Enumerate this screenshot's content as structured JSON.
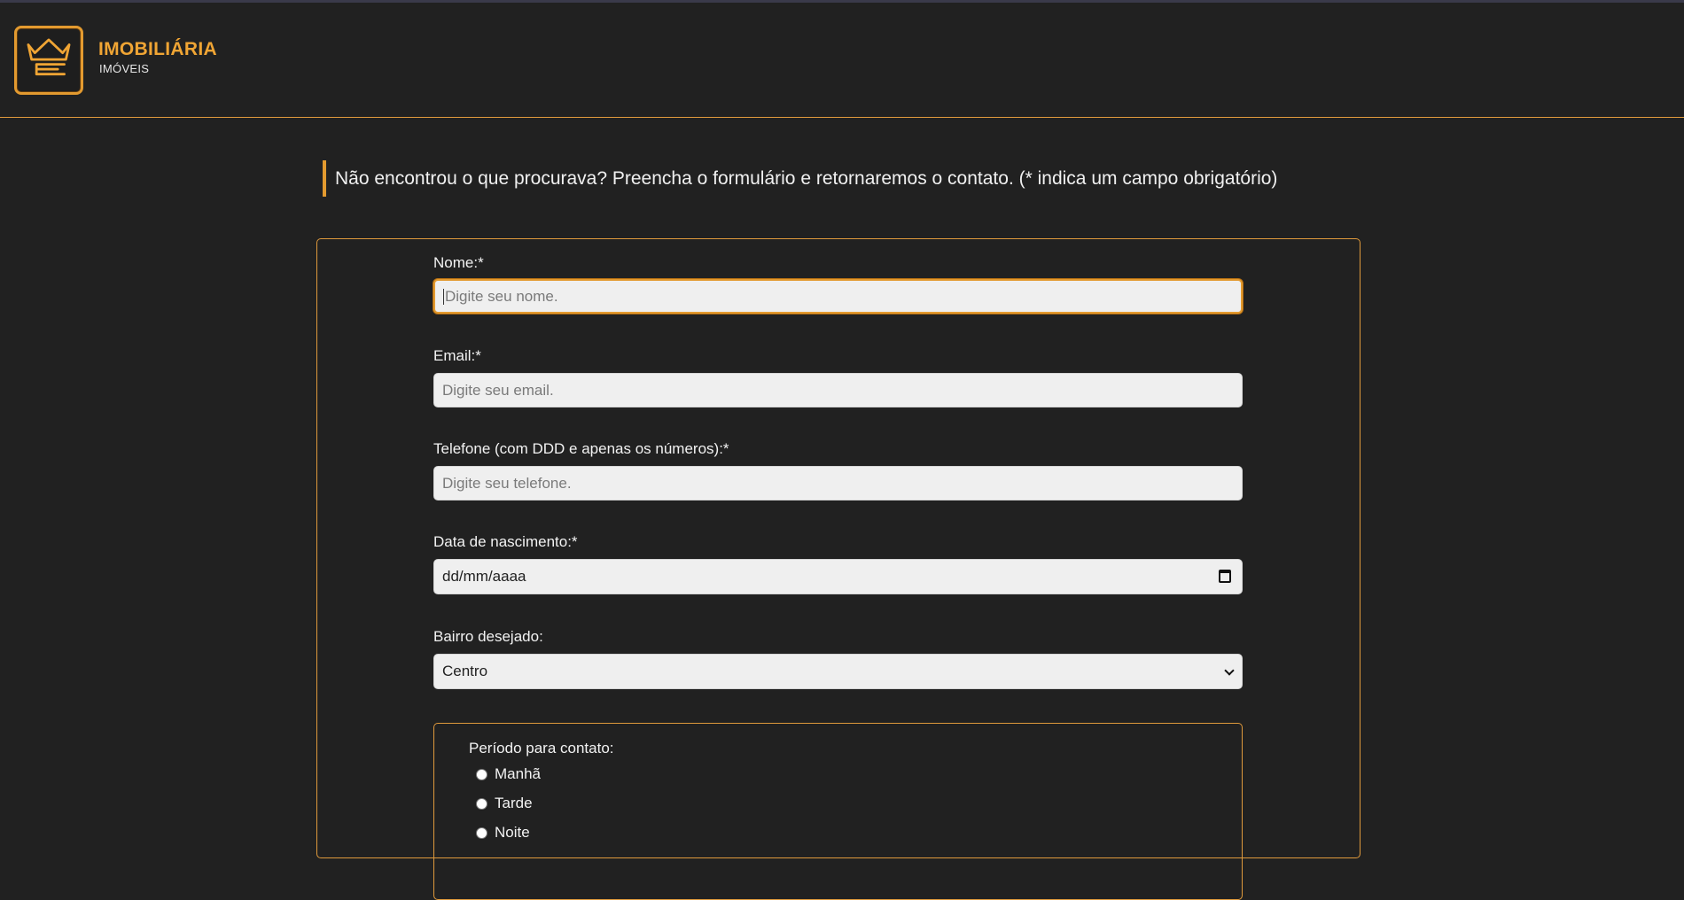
{
  "brand": {
    "name": "IMOBILIÁRIA",
    "subtitle": "IMÓVEIS",
    "accent_color": "#e39a2f"
  },
  "intro_text": "Não encontrou o que procurava? Preencha o formulário e retornaremos o contato. (* indica um campo obrigatório)",
  "form": {
    "name": {
      "label": "Nome:*",
      "placeholder": "Digite seu nome.",
      "value": ""
    },
    "email": {
      "label": "Email:*",
      "placeholder": "Digite seu email.",
      "value": ""
    },
    "phone": {
      "label": "Telefone (com DDD e apenas os números):*",
      "placeholder": "Digite seu telefone.",
      "value": ""
    },
    "birthdate": {
      "label": "Data de nascimento:*",
      "display": "dd/mm/aaaa",
      "icon": "calendar-icon"
    },
    "neighborhood": {
      "label": "Bairro desejado:",
      "selected": "Centro",
      "icon": "chevron-down-icon"
    },
    "contact_period": {
      "legend": "Período para contato:",
      "options": [
        "Manhã",
        "Tarde",
        "Noite"
      ]
    }
  }
}
